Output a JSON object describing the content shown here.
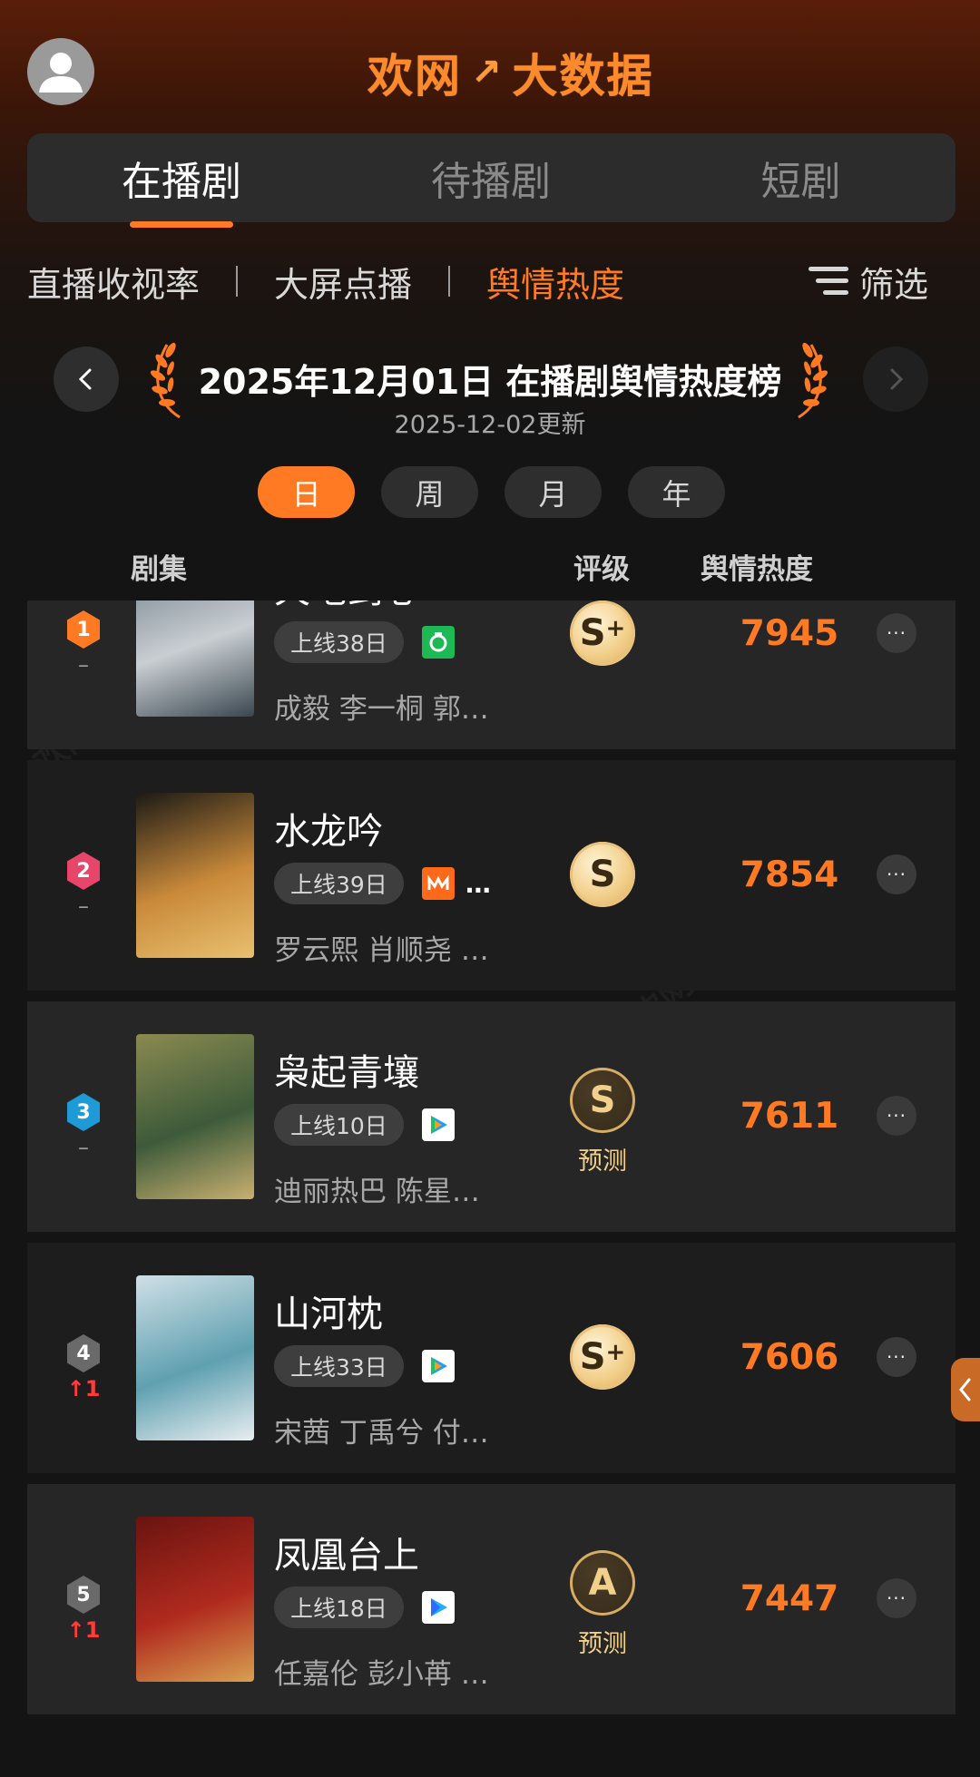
{
  "header": {
    "logo_left": "欢网",
    "logo_right": "大数据",
    "avatar_icon": "user-avatar-icon"
  },
  "main_tabs": [
    {
      "label": "在播剧",
      "active": true
    },
    {
      "label": "待播剧",
      "active": false
    },
    {
      "label": "短剧",
      "active": false
    }
  ],
  "sub_tabs": [
    {
      "label": "直播收视率",
      "active": false
    },
    {
      "label": "大屏点播",
      "active": false
    },
    {
      "label": "舆情热度",
      "active": true
    }
  ],
  "filter": {
    "label": "筛选",
    "icon": "filter-lines-icon"
  },
  "date_header": {
    "title": "2025年12月01日 在播剧舆情热度榜",
    "updated": "2025-12-02更新"
  },
  "periods": [
    {
      "label": "日",
      "active": true
    },
    {
      "label": "周",
      "active": false
    },
    {
      "label": "月",
      "active": false
    },
    {
      "label": "年",
      "active": false
    }
  ],
  "columns": {
    "series": "剧集",
    "grade": "评级",
    "heat": "舆情热度"
  },
  "rows": [
    {
      "rank": "1",
      "badge_color": "#ff7a22",
      "change": "–",
      "change_up": false,
      "title": "天地剑心",
      "days": "上线38日",
      "platform": "iqiyi-icon",
      "platform_color": "#1db954",
      "extra": "",
      "cast": "成毅 李一桐 郭…",
      "grade": "S",
      "plus": "+",
      "predicted": false,
      "pred_label": "",
      "heat": "7945",
      "poster_colors": [
        "#6b7b86",
        "#c9ced2",
        "#3a4750"
      ]
    },
    {
      "rank": "2",
      "badge_color": "#e8456a",
      "change": "–",
      "change_up": false,
      "title": "水龙吟",
      "days": "上线39日",
      "platform": "mango-tv-icon",
      "platform_color": "#ff6a1a",
      "extra": "…",
      "cast": "罗云熙 肖顺尧 …",
      "grade": "S",
      "plus": "",
      "predicted": false,
      "pred_label": "",
      "heat": "7854",
      "poster_colors": [
        "#1c1a16",
        "#c98a3a",
        "#e8c070"
      ]
    },
    {
      "rank": "3",
      "badge_color": "#1e9bd6",
      "change": "–",
      "change_up": false,
      "title": "枭起青壤",
      "days": "上线10日",
      "platform": "tencent-video-icon",
      "platform_color": "#ffffff",
      "extra": "",
      "cast": "迪丽热巴 陈星…",
      "grade": "S",
      "plus": "",
      "predicted": true,
      "pred_label": "预测",
      "heat": "7611",
      "poster_colors": [
        "#8a8a50",
        "#3d5a3a",
        "#c8b070"
      ]
    },
    {
      "rank": "4",
      "badge_color": "#6a6a6a",
      "change": "↑1",
      "change_up": true,
      "title": "山河枕",
      "days": "上线33日",
      "platform": "tencent-video-icon",
      "platform_color": "#ffffff",
      "extra": "",
      "cast": "宋茜 丁禹兮 付…",
      "grade": "S",
      "plus": "+",
      "predicted": false,
      "pred_label": "",
      "heat": "7606",
      "poster_colors": [
        "#cfe0e6",
        "#5fa0b0",
        "#e8eef0"
      ]
    },
    {
      "rank": "5",
      "badge_color": "#6a6a6a",
      "change": "↑1",
      "change_up": true,
      "title": "凤凰台上",
      "days": "上线18日",
      "platform": "youku-icon",
      "platform_color": "#ffffff",
      "extra": "",
      "cast": "任嘉伦 彭小苒 …",
      "grade": "A",
      "plus": "",
      "predicted": true,
      "pred_label": "预测",
      "heat": "7447",
      "poster_colors": [
        "#6a1410",
        "#b02a1e",
        "#d8a050"
      ]
    }
  ],
  "watermark": "欢网大数据"
}
